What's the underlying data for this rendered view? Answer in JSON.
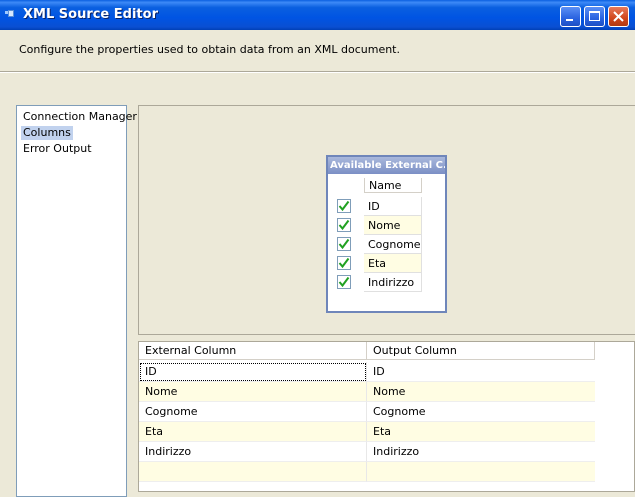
{
  "window": {
    "title": "XML Source Editor"
  },
  "description": "Configure the properties used to obtain data from an XML document.",
  "nav": {
    "items": [
      {
        "label": "Connection Manager",
        "selected": false
      },
      {
        "label": "Columns",
        "selected": true
      },
      {
        "label": "Error Output",
        "selected": false
      }
    ]
  },
  "available_columns": {
    "title": "Available External C...",
    "header": "Name",
    "items": [
      {
        "label": "ID",
        "checked": true
      },
      {
        "label": "Nome",
        "checked": true
      },
      {
        "label": "Cognome",
        "checked": true
      },
      {
        "label": "Eta",
        "checked": true
      },
      {
        "label": "Indirizzo",
        "checked": true
      }
    ]
  },
  "grid": {
    "headers": [
      "External Column",
      "Output Column"
    ],
    "rows": [
      [
        "ID",
        "ID"
      ],
      [
        "Nome",
        "Nome"
      ],
      [
        "Cognome",
        "Cognome"
      ],
      [
        "Eta",
        "Eta"
      ],
      [
        "Indirizzo",
        "Indirizzo"
      ],
      [
        "",
        ""
      ]
    ]
  },
  "colors": {
    "titlebar": "#0054e3",
    "selected_nav": "#c1d2ee",
    "alt_row": "#fffde3",
    "checkmark": "#21a121"
  }
}
